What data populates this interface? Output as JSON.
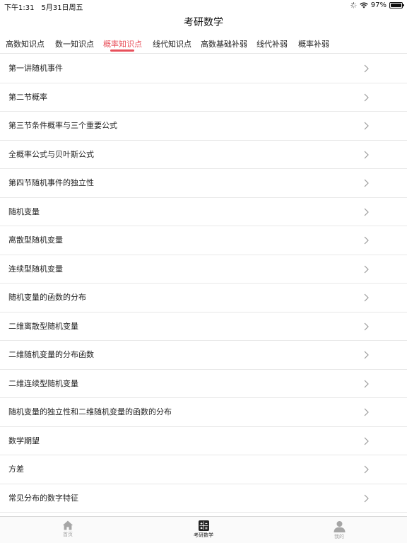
{
  "status_bar": {
    "time": "下午1:31",
    "date": "5月31日周五",
    "battery_text": "97%",
    "battery_level": 0.97
  },
  "nav": {
    "title": "考研数学"
  },
  "tabs": [
    {
      "label": "高数知识点",
      "active": false
    },
    {
      "label": "数一知识点",
      "active": false
    },
    {
      "label": "概率知识点",
      "active": true
    },
    {
      "label": "线代知识点",
      "active": false
    },
    {
      "label": "高数基础补弱",
      "active": false
    },
    {
      "label": "线代补弱",
      "active": false
    },
    {
      "label": "概率补弱",
      "active": false
    }
  ],
  "list": {
    "items": [
      {
        "label": "第一讲随机事件"
      },
      {
        "label": "第二节概率"
      },
      {
        "label": "第三节条件概率与三个重要公式"
      },
      {
        "label": "全概率公式与贝叶斯公式"
      },
      {
        "label": "第四节随机事件的独立性"
      },
      {
        "label": "随机变量"
      },
      {
        "label": "离散型随机变量"
      },
      {
        "label": "连续型随机变量"
      },
      {
        "label": "随机变量的函数的分布"
      },
      {
        "label": "二维离散型随机变量"
      },
      {
        "label": "二维随机变量的分布函数"
      },
      {
        "label": "二维连续型随机变量"
      },
      {
        "label": "随机变量的独立性和二维随机变量的函数的分布"
      },
      {
        "label": "数学期望"
      },
      {
        "label": "方差"
      },
      {
        "label": "常见分布的数字特征"
      }
    ]
  },
  "tabbar": {
    "items": [
      {
        "label": "首页",
        "icon": "home-icon",
        "active": false
      },
      {
        "label": "考研数学",
        "icon": "calculator-icon",
        "active": true
      },
      {
        "label": "我的",
        "icon": "person-icon",
        "active": false
      }
    ]
  },
  "colors": {
    "accent": "#e8505b",
    "text": "#222222",
    "inactive_tab_icon": "#a6a6a6",
    "divider": "#e8e8e8"
  }
}
